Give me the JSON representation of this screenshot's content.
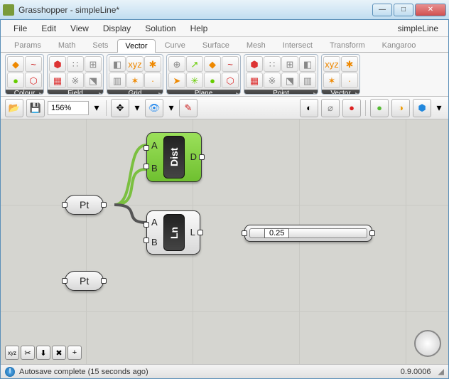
{
  "title": "Grasshopper - simpleLine*",
  "doc_name": "simpleLine",
  "menu": [
    "File",
    "Edit",
    "View",
    "Display",
    "Solution",
    "Help"
  ],
  "tabs": [
    "Params",
    "Math",
    "Sets",
    "Vector",
    "Curve",
    "Surface",
    "Mesh",
    "Intersect",
    "Transform",
    "Kangaroo"
  ],
  "active_tab": "Vector",
  "ribbon_groups": [
    {
      "name": "Colour",
      "tool_count": 4
    },
    {
      "name": "Field",
      "tool_count": 6
    },
    {
      "name": "Grid",
      "tool_count": 6
    },
    {
      "name": "Plane",
      "tool_count": 8
    },
    {
      "name": "Point",
      "tool_count": 8
    },
    {
      "name": "Vector",
      "tool_count": 4
    }
  ],
  "zoom": "156%",
  "components": {
    "pt1": {
      "label": "Pt"
    },
    "pt2": {
      "label": "Pt"
    },
    "dist": {
      "core": "Dist",
      "in": [
        "A",
        "B"
      ],
      "out": [
        "D"
      ]
    },
    "line": {
      "core": "Ln",
      "in": [
        "A",
        "B"
      ],
      "out": [
        "L"
      ]
    },
    "slider": {
      "value": "0.25"
    }
  },
  "canvas_buttons": [
    "xyz-icon",
    "pin-icon",
    "download-icon",
    "close-icon",
    "add-icon"
  ],
  "status_msg": "Autosave complete (15 seconds ago)",
  "version": "0.9.0006"
}
